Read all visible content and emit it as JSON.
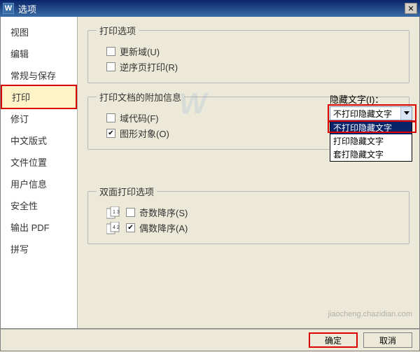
{
  "titlebar": {
    "icon": "W",
    "title": "选项",
    "close": "✕"
  },
  "sidebar": {
    "items": [
      {
        "label": "视图"
      },
      {
        "label": "编辑"
      },
      {
        "label": "常规与保存"
      },
      {
        "label": "打印",
        "active": true
      },
      {
        "label": "修订"
      },
      {
        "label": "中文版式"
      },
      {
        "label": "文件位置"
      },
      {
        "label": "用户信息"
      },
      {
        "label": "安全性"
      },
      {
        "label": "输出 PDF"
      },
      {
        "label": "拼写"
      }
    ]
  },
  "groups": {
    "print_options": {
      "legend": "打印选项",
      "update_fields": "更新域(U)",
      "reverse_order": "逆序页打印(R)"
    },
    "doc_append": {
      "legend": "打印文档的附加信息",
      "field_codes": "域代码(F)",
      "graphics": "图形对象(O)",
      "hidden_text_label": "隐藏文字(I)：",
      "hidden_text_value": "不打印隐藏文字",
      "hidden_options": [
        "不打印隐藏文字",
        "打印隐藏文字",
        "套打隐藏文字"
      ]
    },
    "duplex": {
      "legend": "双面打印选项",
      "odd_desc": "奇数降序(S)",
      "even_desc": "偶数降序(A)"
    }
  },
  "footer": {
    "ok": "确定",
    "cancel": "取消"
  },
  "watermark": "W",
  "watermark2": "jiaocheng.chazidian.com"
}
